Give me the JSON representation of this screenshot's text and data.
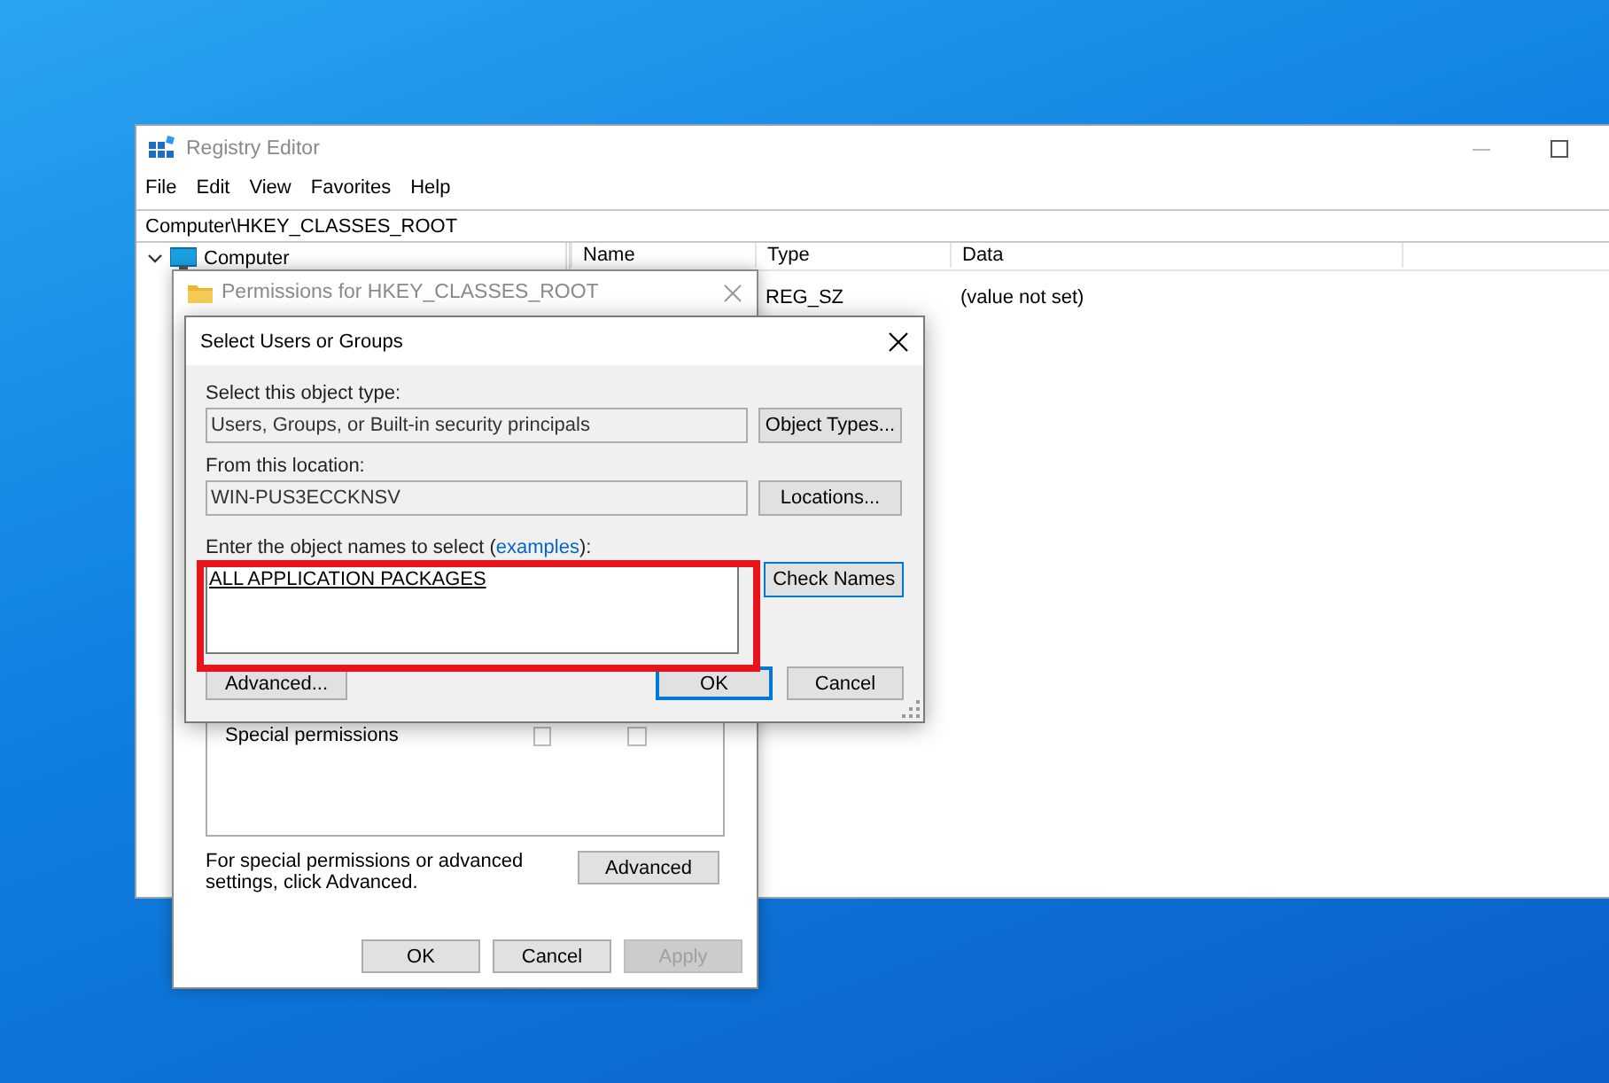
{
  "registry_editor": {
    "title": "Registry Editor",
    "menu": [
      "File",
      "Edit",
      "View",
      "Favorites",
      "Help"
    ],
    "address": "Computer\\HKEY_CLASSES_ROOT",
    "tree": [
      {
        "label": "Computer",
        "expanded": true
      }
    ],
    "columns": [
      "Name",
      "Type",
      "Data"
    ],
    "rows": [
      {
        "type": "REG_SZ",
        "data": "(value not set)"
      }
    ]
  },
  "permissions_dialog": {
    "title": "Permissions for HKEY_CLASSES_ROOT",
    "active": false,
    "permissions": [
      {
        "label": "Special permissions",
        "allow": false,
        "deny": false
      }
    ],
    "advanced_note": "For special permissions or advanced settings, click Advanced.",
    "advanced_button": "Advanced",
    "buttons": [
      {
        "label": "OK",
        "disabled": false
      },
      {
        "label": "Cancel",
        "disabled": false
      },
      {
        "label": "Apply",
        "disabled": true
      }
    ]
  },
  "select_dialog": {
    "title": "Select Users or Groups",
    "object_type": {
      "label": "Select this object type:",
      "value": "Users, Groups, or Built-in security principals",
      "button": "Object Types..."
    },
    "location": {
      "label": "From this location:",
      "value": "WIN-PUS3ECCKNSV",
      "button": "Locations..."
    },
    "names": {
      "label": "Enter the object names to select (",
      "link": "examples",
      "label_end": "):",
      "value": "ALL APPLICATION PACKAGES",
      "resolved": true,
      "highlighted": true,
      "button": "Check Names"
    },
    "buttons": [
      {
        "label": "Advanced...",
        "default": false
      },
      {
        "label": "OK",
        "default": true
      },
      {
        "label": "Cancel",
        "default": false
      }
    ]
  }
}
